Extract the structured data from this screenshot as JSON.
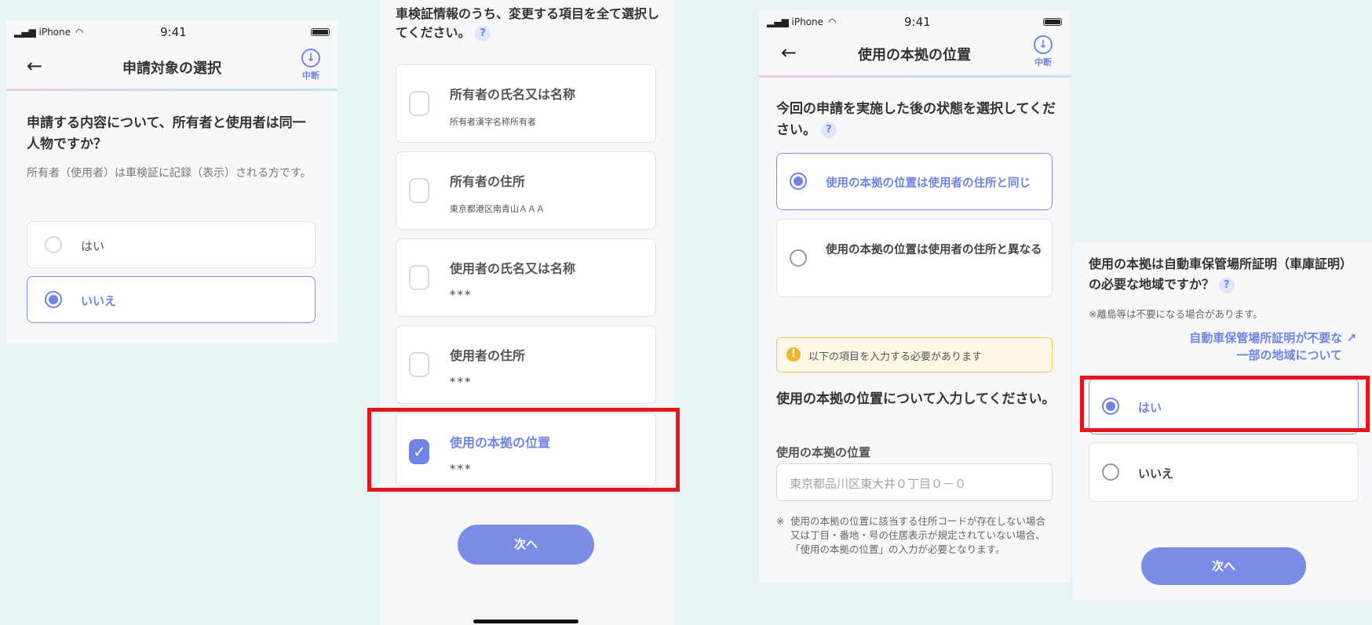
{
  "status_bar": {
    "carrier": "iPhone",
    "time": "9:41"
  },
  "screen1": {
    "nav_title": "申請対象の選択",
    "pause_label": "中断",
    "question": "申請する内容について、所有者と使用者は同一人物ですか？",
    "description": "所有者（使用者）は車検証に記録（表示）される方です。",
    "options": [
      {
        "label": "はい",
        "selected": false
      },
      {
        "label": "いいえ",
        "selected": true
      }
    ]
  },
  "screen2": {
    "heading": "車検証情報のうち、変更する項目を全て選択してください。",
    "items": [
      {
        "title": "所有者の氏名又は名称",
        "value": "所有者漢字名称所有者",
        "checked": false
      },
      {
        "title": "所有者の住所",
        "value": "東京都港区南青山ＡＡＡ",
        "checked": false
      },
      {
        "title": "使用者の氏名又は名称",
        "value": "***",
        "checked": false
      },
      {
        "title": "使用者の住所",
        "value": "***",
        "checked": false
      },
      {
        "title": "使用の本拠の位置",
        "value": "***",
        "checked": true
      }
    ],
    "next_label": "次へ"
  },
  "screen3": {
    "nav_title": "使用の本拠の位置",
    "pause_label": "中断",
    "question": "今回の申請を実施した後の状態を選択してください。",
    "options": [
      {
        "label": "使用の本拠の位置は使用者の住所と同じ",
        "selected": true
      },
      {
        "label": "使用の本拠の位置は使用者の住所と異なる",
        "selected": false
      }
    ],
    "notice": "以下の項目を入力する必要があります",
    "section_title": "使用の本拠の位置について入力してください。",
    "field_label": "使用の本拠の位置",
    "field_placeholder": "東京都品川区東大井０丁目０－０",
    "footnote_mark": "※",
    "footnote": "使用の本拠の位置に該当する住所コードが存在しない場合又は丁目・番地・号の住居表示が規定されていない場合、「使用の本拠の位置」の入力が必要となります。"
  },
  "screen4": {
    "question": "使用の本拠は自動車保管場所証明（車庫証明）の必要な地域ですか？",
    "note": "※離島等は不要になる場合があります。",
    "link_line1": "自動車保管場所証明が不要な ↗",
    "link_line2": "一部の地域について",
    "options": [
      {
        "label": "はい",
        "selected": true
      },
      {
        "label": "いいえ",
        "selected": false
      }
    ],
    "next_label": "次へ"
  },
  "colors": {
    "accent": "#6f85e6",
    "highlight": "#e8141b",
    "background": "#e8f4f4"
  }
}
